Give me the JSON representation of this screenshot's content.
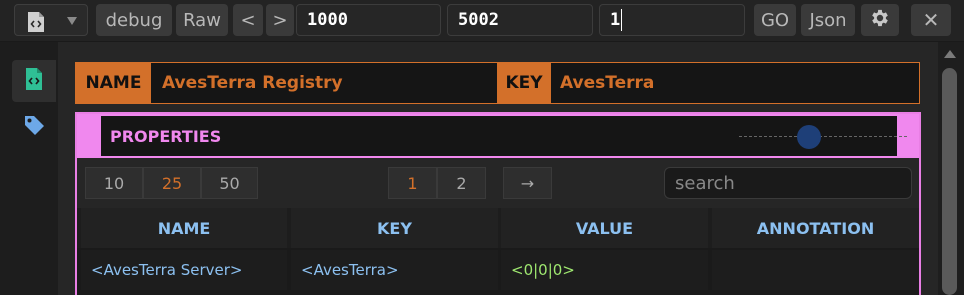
{
  "toolbar": {
    "debug_label": "debug",
    "raw_label": "Raw",
    "prev_label": "<",
    "next_label": ">",
    "field1": "1000",
    "field2": "5002",
    "field3": "1",
    "go_label": "GO",
    "json_label": "Json",
    "settings_icon": "gear-icon",
    "close_label": "✕"
  },
  "rail": {
    "items": [
      {
        "icon": "document-code-icon",
        "active": true
      },
      {
        "icon": "tag-icon",
        "active": false
      }
    ]
  },
  "header": {
    "name_label": "NAME",
    "name_value": "AvesTerra Registry",
    "key_label": "KEY",
    "key_value": "AvesTerra"
  },
  "properties": {
    "title": "PROPERTIES",
    "page_sizes": [
      "10",
      "25",
      "50"
    ],
    "selected_page_size": "25",
    "pages": [
      "1",
      "2"
    ],
    "current_page": "1",
    "next_arrow": "→",
    "search_placeholder": "search",
    "columns": [
      "NAME",
      "KEY",
      "VALUE",
      "ANNOTATION"
    ],
    "rows": [
      {
        "name": "<AvesTerra Server>",
        "key": "<AvesTerra>",
        "value": "<0|0|0>",
        "annotation": ""
      }
    ]
  },
  "colors": {
    "accent_orange": "#d3702a",
    "accent_pink": "#f088ee",
    "header_blue": "#8cc0f0",
    "value_green": "#9fe870",
    "knob_blue": "#1e3f78"
  }
}
